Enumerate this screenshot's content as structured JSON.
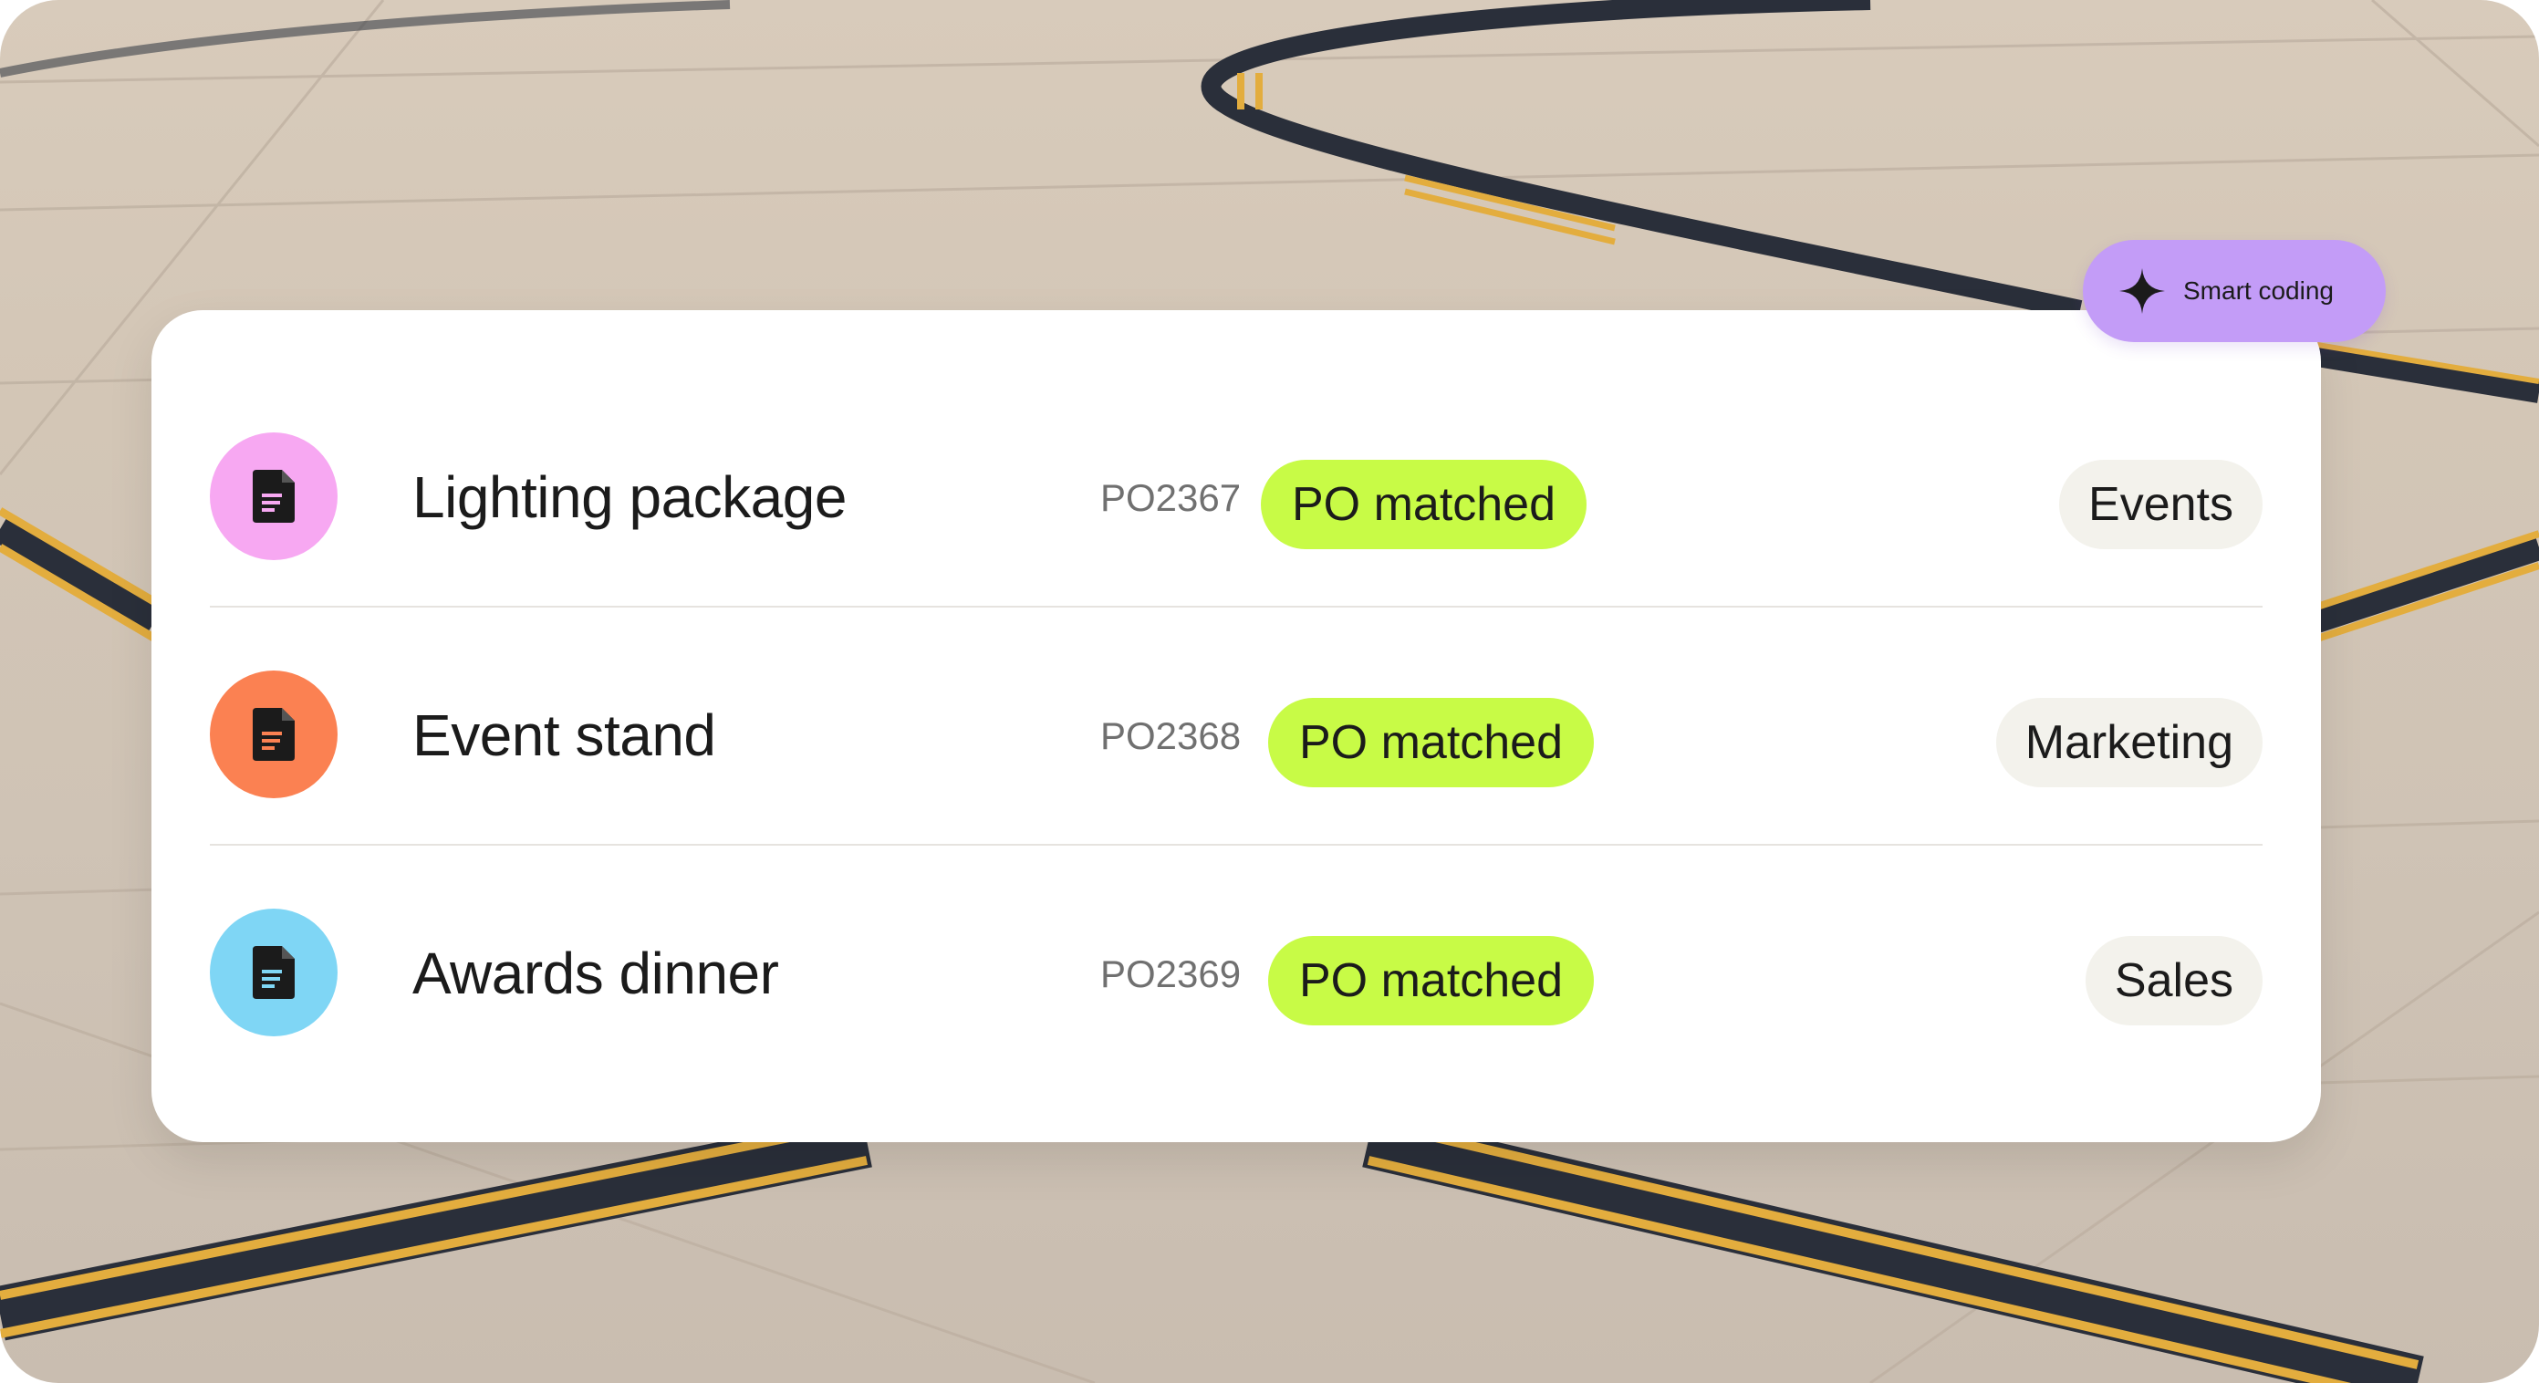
{
  "smart_coding": {
    "label": "Smart coding",
    "icon": "sparkle-icon",
    "color": "#c39cf7"
  },
  "rows": [
    {
      "title": "Lighting package",
      "po": "PO2367",
      "status": "PO matched",
      "category": "Events",
      "icon": "document-icon",
      "icon_bg": "#f7a8f2"
    },
    {
      "title": "Event stand",
      "po": "PO2368",
      "status": "PO matched",
      "category": "Marketing",
      "icon": "document-icon",
      "icon_bg": "#fb8152"
    },
    {
      "title": "Awards dinner",
      "po": "PO2369",
      "status": "PO matched",
      "category": "Sales",
      "icon": "document-icon",
      "icon_bg": "#7fd6f5"
    }
  ],
  "colors": {
    "status_badge": "#c8fb46",
    "category_tag": "#f3f2ec",
    "icon_glyph": "#1b1b1b",
    "icon_lines": [
      "#f7a8f2",
      "#fb8152",
      "#7fd6f5"
    ]
  }
}
